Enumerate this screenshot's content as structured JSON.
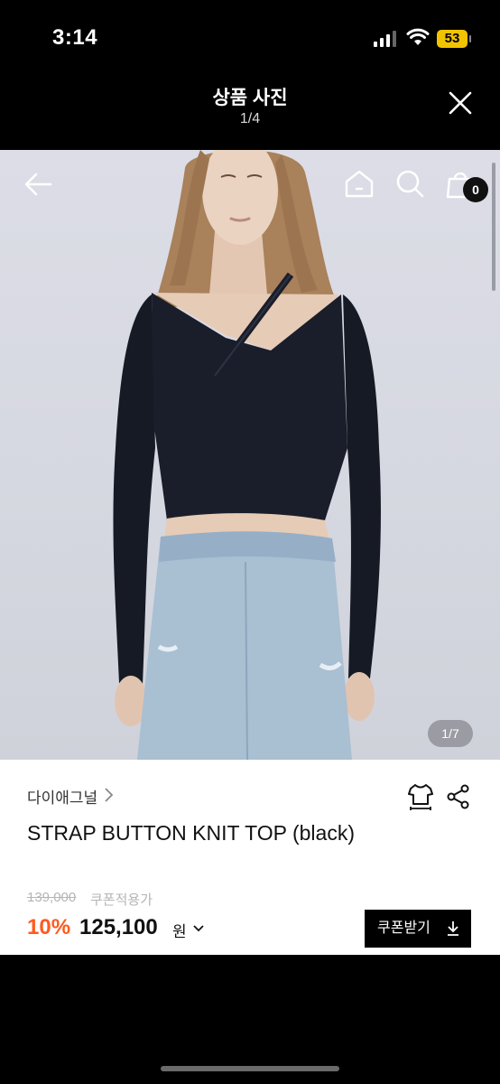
{
  "status_bar": {
    "time": "3:14",
    "battery": "53"
  },
  "viewer": {
    "title": "상품 사진",
    "counter": "1/4"
  },
  "product_photo": {
    "counter": "1/7",
    "cart_count": "0"
  },
  "product": {
    "brand": "다이애그널",
    "name": "STRAP BUTTON KNIT TOP (black)",
    "original_price": "139,000",
    "coupon_applied_label": "쿠폰적용가",
    "discount": "10%",
    "price": "125,100",
    "currency": "원",
    "coupon_button": "쿠폰받기"
  },
  "colors": {
    "discount": "#ff5a1f",
    "battery": "#f2c400"
  }
}
